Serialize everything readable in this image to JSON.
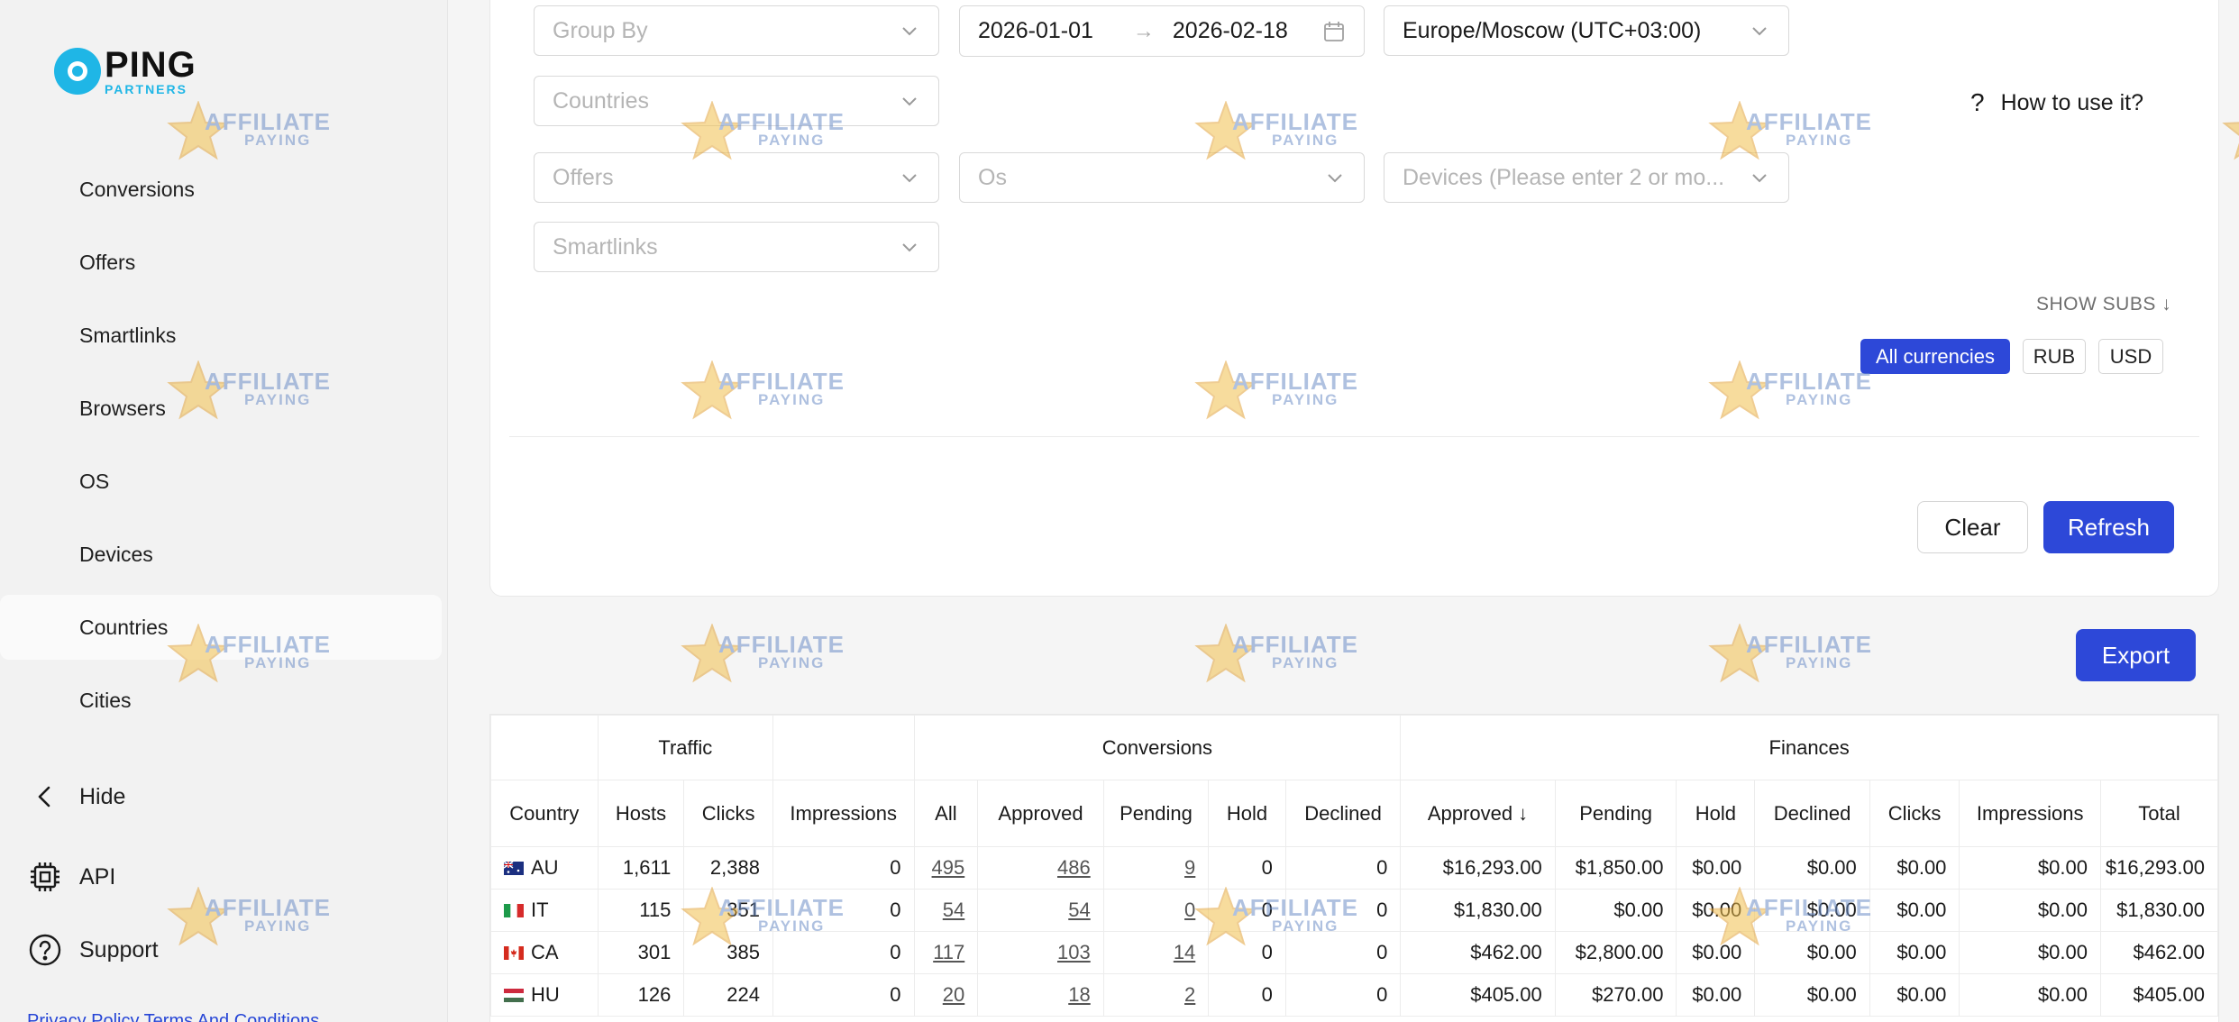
{
  "brand": {
    "name": "PING",
    "sub": "PARTNERS"
  },
  "sidebar": {
    "items": [
      {
        "label": "Conversions"
      },
      {
        "label": "Offers"
      },
      {
        "label": "Smartlinks"
      },
      {
        "label": "Browsers"
      },
      {
        "label": "OS"
      },
      {
        "label": "Devices"
      },
      {
        "label": "Countries",
        "active": true
      },
      {
        "label": "Cities"
      }
    ],
    "hide_label": "Hide",
    "api_label": "API",
    "support_label": "Support",
    "footer_links": "Privacy Policy   Terms And Conditions"
  },
  "filters": {
    "group_by": {
      "placeholder": "Group By"
    },
    "date_from": "2026-01-01",
    "date_to": "2026-02-18",
    "date_arrow": "→",
    "timezone": "Europe/Moscow (UTC+03:00)",
    "countries": {
      "placeholder": "Countries"
    },
    "offers": {
      "placeholder": "Offers"
    },
    "os": {
      "placeholder": "Os"
    },
    "devices": {
      "placeholder": "Devices (Please enter 2 or mo..."
    },
    "smartlinks": {
      "placeholder": "Smartlinks"
    }
  },
  "help": {
    "icon": "?",
    "label": "How to use it?"
  },
  "show_subs": "SHOW SUBS ↓",
  "currencies": [
    {
      "label": "All currencies",
      "active": true
    },
    {
      "label": "RUB"
    },
    {
      "label": "USD"
    }
  ],
  "actions": {
    "clear": "Clear",
    "refresh": "Refresh",
    "export": "Export"
  },
  "watermark": {
    "line1": "AFFILIATE",
    "line2": "PAYING"
  },
  "table": {
    "groups": {
      "traffic": "Traffic",
      "conversions": "Conversions",
      "finances": "Finances"
    },
    "headers": [
      "Country",
      "Hosts",
      "Clicks",
      "Impressions",
      "All",
      "Approved",
      "Pending",
      "Hold",
      "Declined",
      "Approved ↓",
      "Pending",
      "Hold",
      "Declined",
      "Clicks",
      "Impressions",
      "Total"
    ],
    "rows": [
      {
        "flag": "au",
        "country": "AU",
        "cells": [
          "1,611",
          "2,388",
          "0",
          "495",
          "486",
          "9",
          "0",
          "0",
          "$16,293.00",
          "$1,850.00",
          "$0.00",
          "$0.00",
          "$0.00",
          "$0.00",
          "$16,293.00"
        ]
      },
      {
        "flag": "it",
        "country": "IT",
        "cells": [
          "115",
          "351",
          "0",
          "54",
          "54",
          "0",
          "0",
          "0",
          "$1,830.00",
          "$0.00",
          "$0.00",
          "$0.00",
          "$0.00",
          "$0.00",
          "$1,830.00"
        ]
      },
      {
        "flag": "ca",
        "country": "CA",
        "cells": [
          "301",
          "385",
          "0",
          "117",
          "103",
          "14",
          "0",
          "0",
          "$462.00",
          "$2,800.00",
          "$0.00",
          "$0.00",
          "$0.00",
          "$0.00",
          "$462.00"
        ]
      },
      {
        "flag": "hu",
        "country": "HU",
        "cells": [
          "126",
          "224",
          "0",
          "20",
          "18",
          "2",
          "0",
          "0",
          "$405.00",
          "$270.00",
          "$0.00",
          "$0.00",
          "$0.00",
          "$0.00",
          "$405.00"
        ]
      }
    ]
  }
}
